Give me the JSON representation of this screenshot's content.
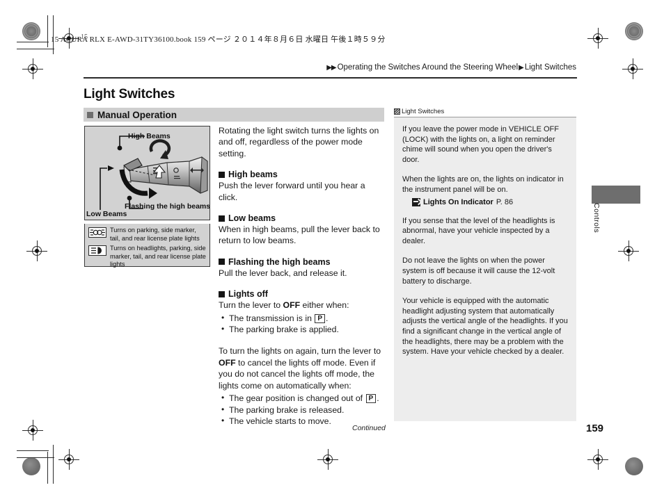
{
  "print": {
    "file_slug": "15 ACURA RLX E-AWD-31TY36100.book   159 ページ   ２０１４年８月６日   水曜日   午後１時５９分",
    "corner_number": "15"
  },
  "breadcrumb": {
    "arrows": "▶▶",
    "parent": "Operating the Switches Around the Steering Wheel",
    "separator": "▶",
    "current": "Light Switches"
  },
  "page": {
    "title": "Light Switches",
    "number": "159",
    "continued_label": "Continued"
  },
  "section": {
    "icon": "filled-square-icon",
    "label": "Manual Operation"
  },
  "illustration": {
    "name": "light-switch-stalk-illustration",
    "labels": {
      "high_beams": "High Beams",
      "low_beams": "Low Beams",
      "flashing": "Flashing the high beams"
    }
  },
  "legend": {
    "rows": [
      {
        "icon": "parking-light-symbol-icon",
        "text": "Turns on parking, side marker, tail, and rear license plate lights"
      },
      {
        "icon": "headlight-symbol-icon",
        "text": "Turns on headlights, parking, side marker, tail, and rear license plate lights"
      }
    ]
  },
  "main": {
    "intro": "Rotating the light switch turns the lights on and off, regardless of the power mode setting.",
    "blocks": [
      {
        "heading": "High beams",
        "body": "Push the lever forward until you hear a click."
      },
      {
        "heading": "Low beams",
        "body": "When in high beams, pull the lever back to return to low beams."
      },
      {
        "heading": "Flashing the high beams",
        "body": "Pull the lever back, and release it."
      }
    ],
    "lights_off": {
      "heading": "Lights off",
      "lead_before": "Turn the lever to ",
      "lead_bold": "OFF",
      "lead_after": " either when:",
      "bullets": [
        {
          "before": "The transmission is in ",
          "gear": "P",
          "after": "."
        },
        {
          "before": "The parking brake is applied.",
          "gear": "",
          "after": ""
        }
      ]
    },
    "turn_on_again": {
      "part1": "To turn the lights on again, turn the lever to ",
      "bold": "OFF",
      "part2": " to cancel the lights off mode. Even if you do not cancel the lights off mode, the lights come on automatically when:",
      "bullets": [
        {
          "before": "The gear position is changed out of ",
          "gear": "P",
          "after": "."
        },
        {
          "before": "The parking brake is released.",
          "gear": "",
          "after": ""
        },
        {
          "before": "The vehicle starts to move.",
          "gear": "",
          "after": ""
        }
      ]
    }
  },
  "sidebar": {
    "icon": "note-marker-icon",
    "title": "Light Switches",
    "paragraphs": [
      "If you leave the power mode in VEHICLE OFF (LOCK) with the lights on, a light on reminder chime will sound when you open the driver's door.",
      "When the lights are on, the lights on indicator in the instrument panel will be on."
    ],
    "cross_reference": {
      "icon": "arrow-jump-icon",
      "title": "Lights On Indicator",
      "page": "P. 86"
    },
    "paragraphs_after": [
      "If you sense that the level of the headlights is abnormal, have your vehicle inspected by a dealer.",
      "Do not leave the lights on when the power system is off because it will cause the 12-volt battery to discharge.",
      "Your vehicle is equipped with the automatic headlight adjusting system that automatically adjusts the vertical angle of the headlights. If you find a significant change in the vertical angle of the headlights, there may be a problem with the system. Have your vehicle checked by a dealer."
    ]
  },
  "thumb_tab": {
    "label": "Controls",
    "color": "#6e6e6e"
  },
  "colors": {
    "band": "#cfcfcf",
    "panel": "#d2d2d2",
    "sidebar": "#ededed",
    "ink": "#1a1a1a"
  }
}
